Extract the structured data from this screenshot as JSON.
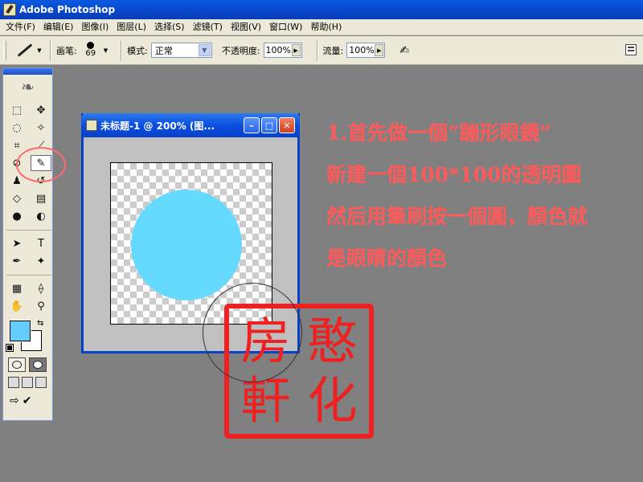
{
  "window": {
    "title": "Adobe Photoshop"
  },
  "menu": [
    "文件(F)",
    "编辑(E)",
    "图像(I)",
    "图层(L)",
    "选择(S)",
    "滤镜(T)",
    "视图(V)",
    "窗口(W)",
    "帮助(H)"
  ],
  "options": {
    "brush_label": "画笔:",
    "brush_size": "69",
    "mode_label": "模式:",
    "mode_value": "正常",
    "opacity_label": "不透明度:",
    "opacity_value": "100%",
    "flow_label": "流量:",
    "flow_value": "100%"
  },
  "colors": {
    "foreground": "#66ccff",
    "background": "#ffffff",
    "accent": "#ff5a5a",
    "seal": "#ee2020",
    "circle_fill": "#66d9ff"
  },
  "document": {
    "title": "未标题-1 @ 200% (图..."
  },
  "icons": [
    "brush-icon",
    "marquee-icon",
    "move-icon",
    "lasso-icon",
    "magic-wand-icon",
    "crop-icon",
    "slice-icon",
    "healing-icon",
    "brush-tool-icon",
    "stamp-icon",
    "history-brush-icon",
    "eraser-icon",
    "gradient-icon",
    "blur-icon",
    "dodge-icon",
    "path-select-icon",
    "type-icon",
    "pen-icon",
    "shape-icon",
    "notes-icon",
    "eyedropper-icon",
    "hand-icon",
    "zoom-icon",
    "swap-colors-icon",
    "default-colors-icon"
  ],
  "annotation": {
    "lines": [
      "1.首先做一個“蹦形眼鏡”",
      "新建一個100*100的透明圖",
      "然后用筆刷按一個圓，顏色就",
      "是眼睛的顏色"
    ]
  },
  "seal": {
    "chars": [
      "憨",
      "房",
      "化",
      "軒"
    ]
  }
}
